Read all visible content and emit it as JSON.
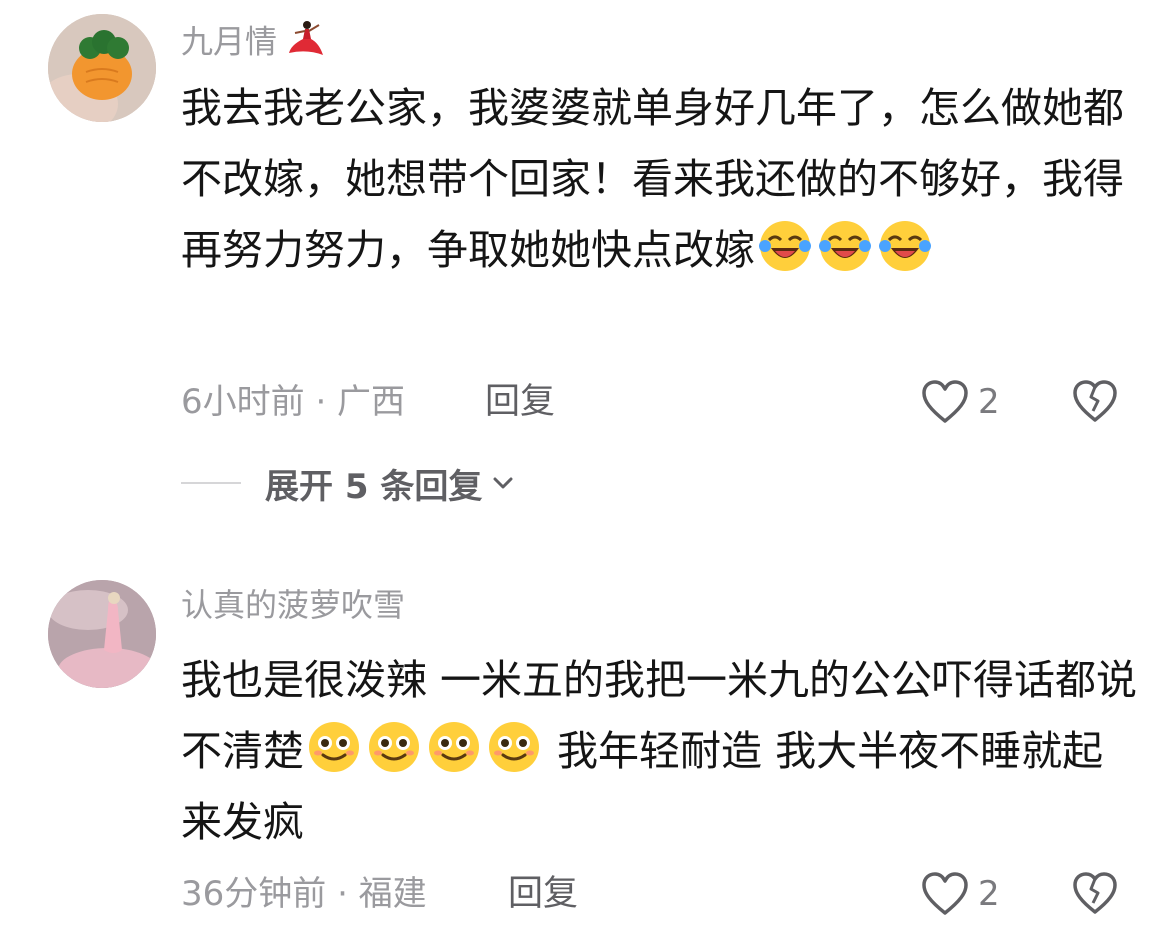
{
  "comments": [
    {
      "username": "九月情",
      "username_emoji": "dancer-emoji",
      "text_parts": [
        "我去我老公家，我婆婆就单身好几年了，怎么做她都不改嫁，她想带个回家！看来我还做的不够好，我得再努力努力，争取她她快点改嫁"
      ],
      "emojis_after": [
        "crying-laughing-emoji",
        "crying-laughing-emoji",
        "crying-laughing-emoji"
      ],
      "meta": "6小时前 · 广西",
      "reply_label": "回复",
      "like_count": "2",
      "expand_label": "展开 5 条回复"
    },
    {
      "username": "认真的菠萝吹雪",
      "text_before": "我也是很泼辣 一米五的我把一米九的公公吓得话都说不清楚",
      "emojis_mid": [
        "smile-emoji",
        "smile-emoji",
        "smile-emoji",
        "smile-emoji"
      ],
      "text_after": " 我年轻耐造 我大半夜不睡就起来发疯",
      "meta": "36分钟前 · 福建",
      "reply_label": "回复",
      "like_count": "2"
    }
  ],
  "colors": {
    "username": "#9a9a9e",
    "text": "#151515",
    "meta": "#9a9a9e",
    "action": "#5f5f63"
  }
}
